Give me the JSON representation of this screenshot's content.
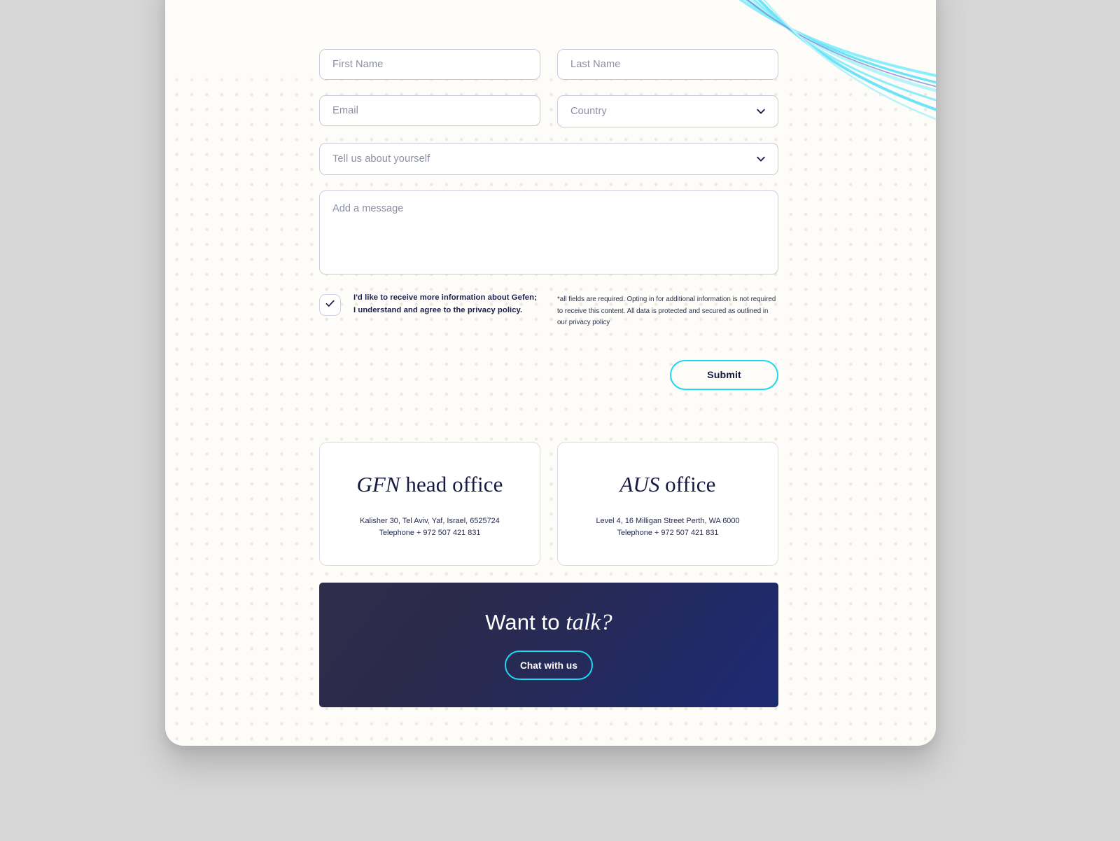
{
  "theme": {
    "page_background": "#fdfcf8",
    "outer_background": "#d7d7d7",
    "accent_cyan": "#1fd8f0",
    "ink_navy": "#151a42",
    "placeholder_gray": "#8b8fa4",
    "field_border": "#c9cade",
    "banner_gradient_start": "#302d4b",
    "banner_gradient_end": "#1d2b74"
  },
  "form": {
    "fields": {
      "first_name": {
        "placeholder": "First Name",
        "value": ""
      },
      "last_name": {
        "placeholder": "Last Name",
        "value": ""
      },
      "email": {
        "placeholder": "Email",
        "value": ""
      },
      "country": {
        "placeholder": "Country",
        "value": "",
        "icon": "chevron-down-icon"
      },
      "about_you": {
        "placeholder": "Tell us about yourself",
        "value": "",
        "icon": "chevron-down-icon"
      },
      "message": {
        "placeholder": "Add a message",
        "value": ""
      }
    },
    "consent": {
      "checked": true,
      "check_icon": "check-icon",
      "line1": "I'd like to receive more information about Gefen;",
      "line2": "I understand and agree to the privacy policy."
    },
    "fineprint": "*all fields are required. Opting in for additional information is not required to receive this content. All data is protected and secured as outlined in our privacy policy",
    "submit_label": "Submit"
  },
  "offices": [
    {
      "abbr": "GFN",
      "title_rest": " head office",
      "address": "Kalisher 30, Tel Aviv, Yaf, Israel, 6525724",
      "phone": "Telephone + 972 507 421 831"
    },
    {
      "abbr": "AUS",
      "title_rest": " office",
      "address": "Level 4, 16 Milligan Street Perth, WA 6000",
      "phone": "Telephone + 972 507 421 831"
    }
  ],
  "cta": {
    "title_lead": "Want to ",
    "title_em": "talk?",
    "button_label": "Chat with us"
  },
  "decor": {
    "swoosh_colors": [
      "#6de4f7",
      "#8ceefb",
      "#b8f3fc",
      "#7f86c8"
    ]
  }
}
